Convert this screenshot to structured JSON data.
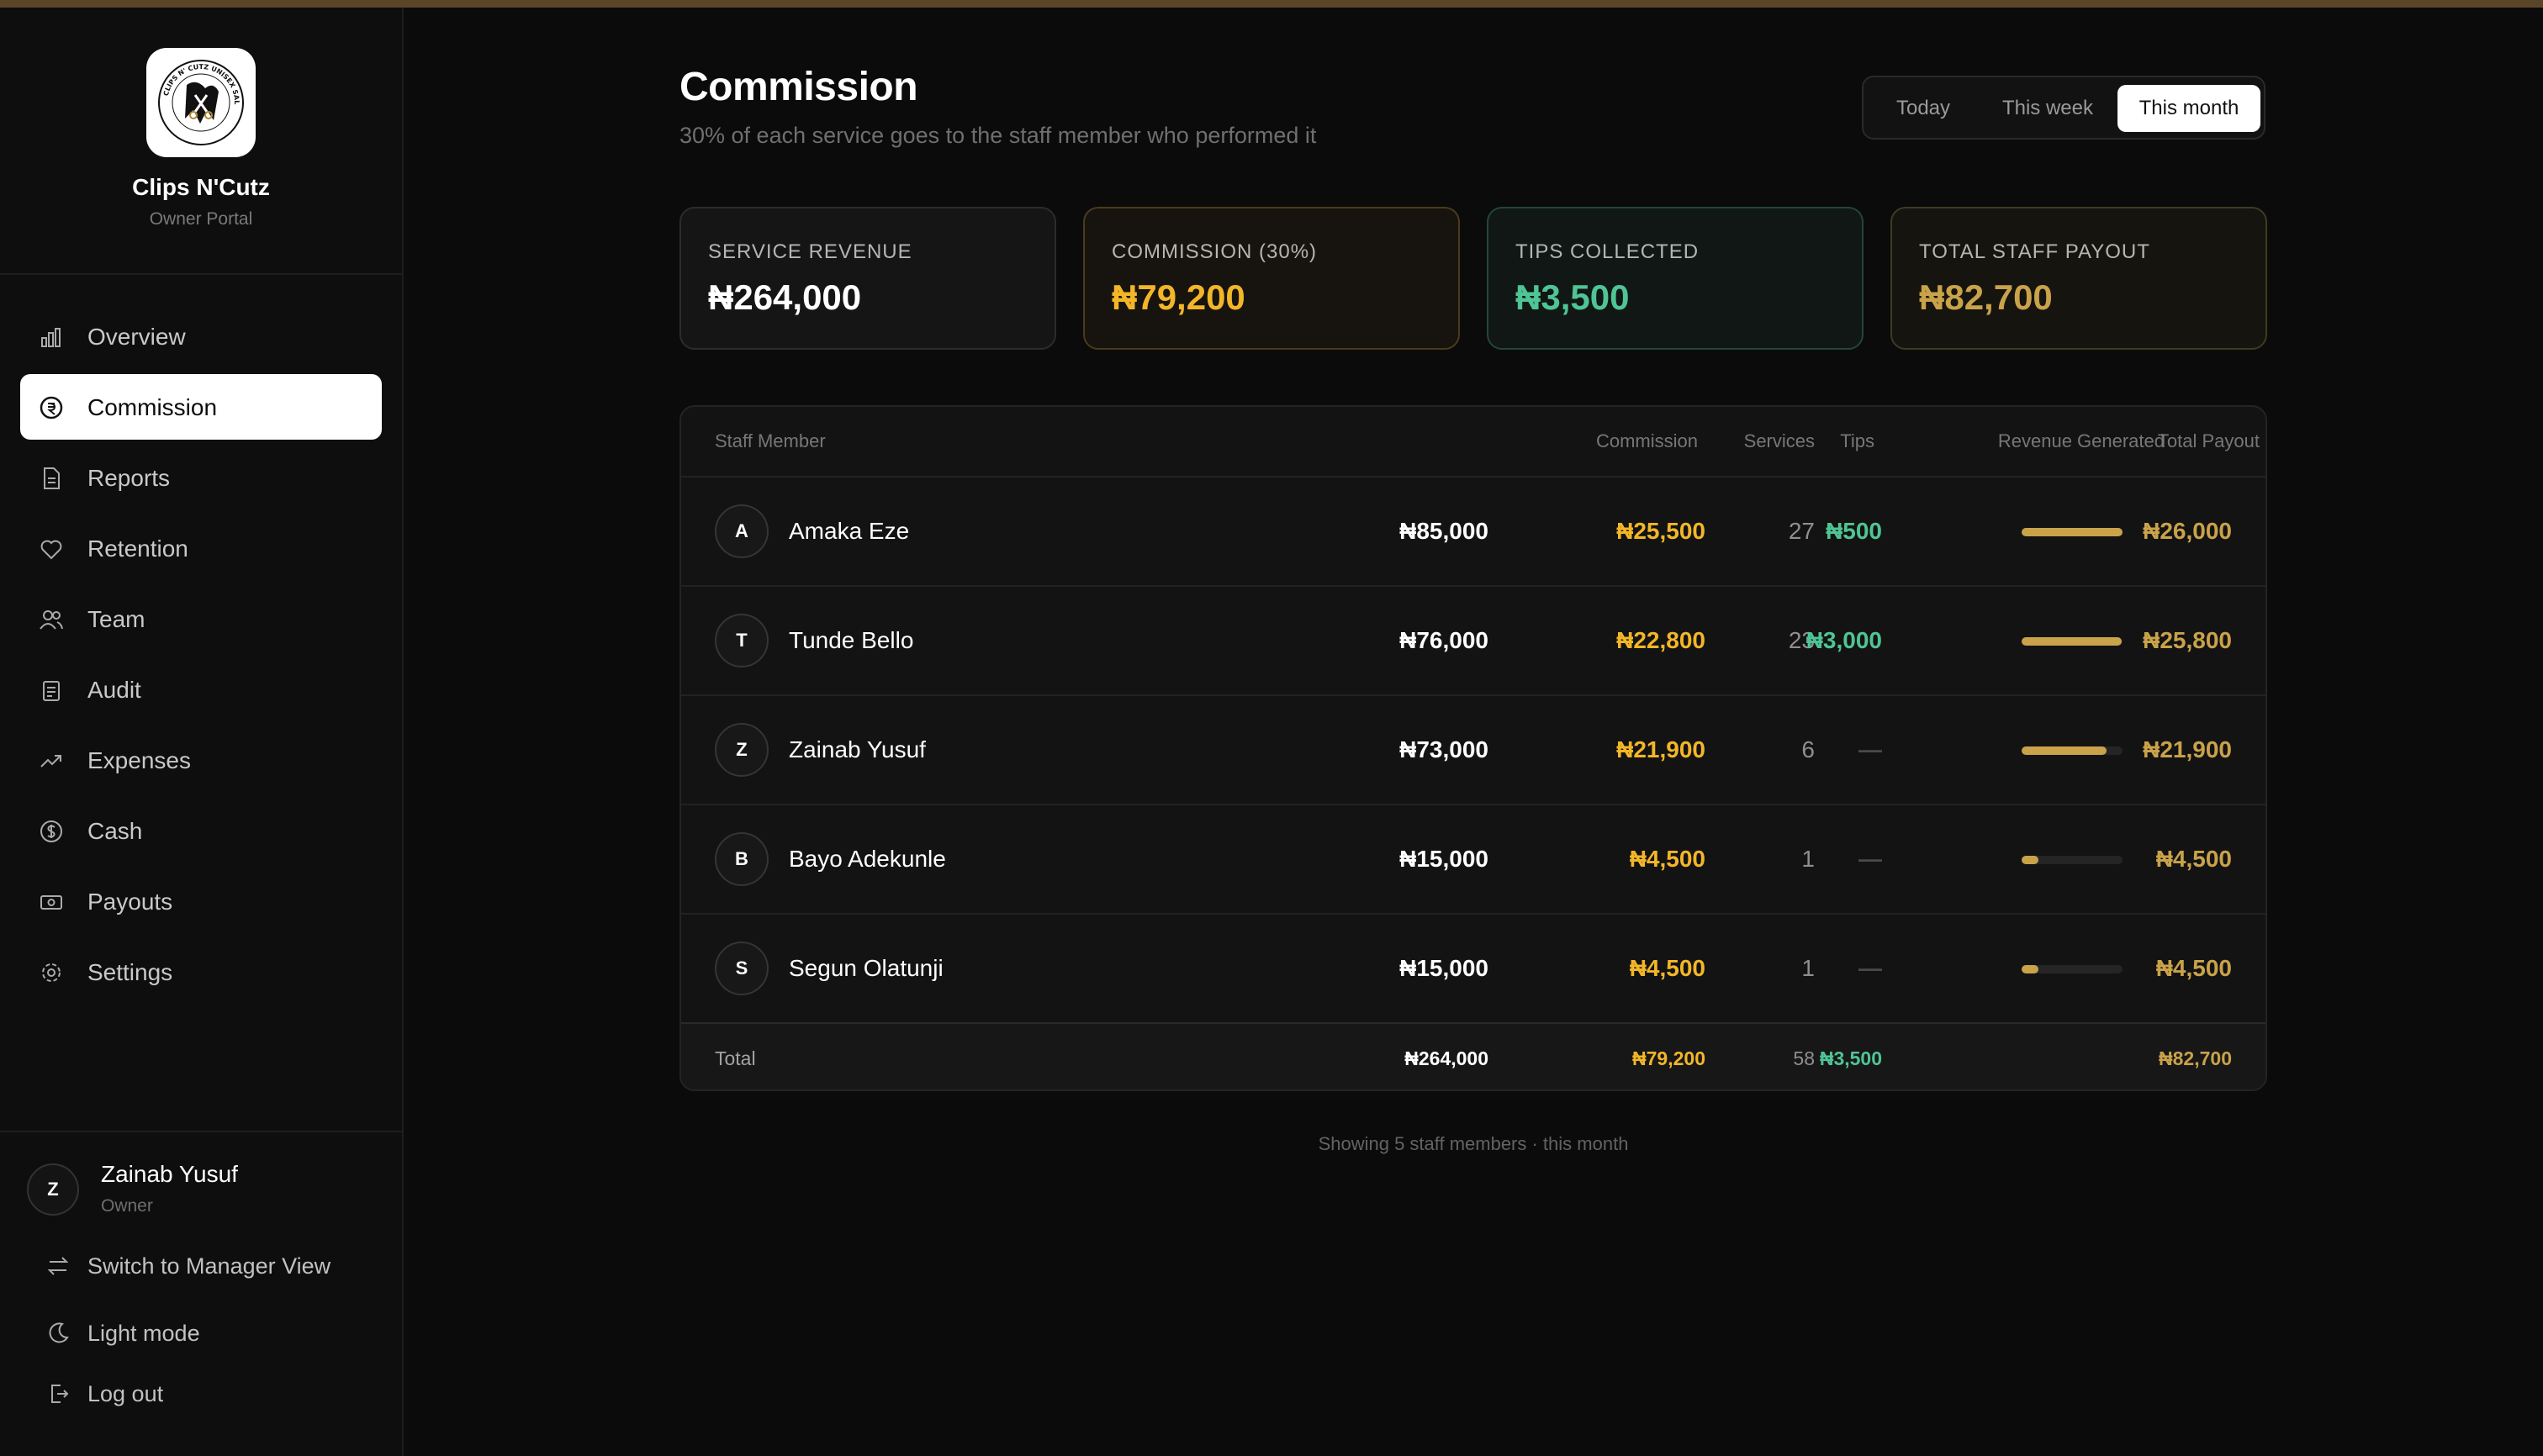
{
  "colors": {
    "accent_gold": "#c9a24a",
    "commission_yellow": "#f2b628",
    "tips_green": "#4fc495",
    "payout_gold": "#c9a24a"
  },
  "brand": {
    "name": "Clips N'Cutz",
    "subtitle": "Owner Portal",
    "logo_text": "CLIPS N' CUTZ UNISEX SALON"
  },
  "nav": [
    {
      "label": "Overview",
      "icon": "bar-chart-icon"
    },
    {
      "label": "Commission",
      "icon": "commission-icon",
      "active": true
    },
    {
      "label": "Reports",
      "icon": "document-icon"
    },
    {
      "label": "Retention",
      "icon": "heart-icon"
    },
    {
      "label": "Team",
      "icon": "users-icon"
    },
    {
      "label": "Audit",
      "icon": "clipboard-icon"
    },
    {
      "label": "Expenses",
      "icon": "trending-up-icon"
    },
    {
      "label": "Cash",
      "icon": "dollar-circle-icon"
    },
    {
      "label": "Payouts",
      "icon": "banknote-icon"
    },
    {
      "label": "Settings",
      "icon": "gear-icon"
    }
  ],
  "user": {
    "initial": "Z",
    "name": "Zainab Yusuf",
    "role": "Owner"
  },
  "sidebar_actions": {
    "switch_view": "Switch to Manager View",
    "theme": "Light mode",
    "logout": "Log out"
  },
  "header": {
    "title": "Commission",
    "subtitle": "30% of each service goes to the staff member who performed it"
  },
  "range": {
    "options": [
      "Today",
      "This week",
      "This month"
    ],
    "selected": "This month"
  },
  "cards": [
    {
      "label": "SERVICE REVENUE",
      "value": "₦264,000"
    },
    {
      "label": "COMMISSION (30%)",
      "value": "₦79,200"
    },
    {
      "label": "TIPS COLLECTED",
      "value": "₦3,500"
    },
    {
      "label": "TOTAL STAFF PAYOUT",
      "value": "₦82,700"
    }
  ],
  "table": {
    "columns": [
      "Staff Member",
      "Services",
      "Revenue Generated",
      "Commission",
      "Tips",
      "Total Payout"
    ],
    "rows": [
      {
        "initial": "A",
        "name": "Amaka Eze",
        "services": "27",
        "revenue": "₦85,000",
        "commission": "₦25,500",
        "tips": "₦500",
        "payout": "₦26,000",
        "payout_share": 1.0
      },
      {
        "initial": "T",
        "name": "Tunde Bello",
        "services": "23",
        "revenue": "₦76,000",
        "commission": "₦22,800",
        "tips": "₦3,000",
        "payout": "₦25,800",
        "payout_share": 0.99
      },
      {
        "initial": "Z",
        "name": "Zainab Yusuf",
        "services": "6",
        "revenue": "₦73,000",
        "commission": "₦21,900",
        "tips": "—",
        "payout": "₦21,900",
        "payout_share": 0.84
      },
      {
        "initial": "B",
        "name": "Bayo Adekunle",
        "services": "1",
        "revenue": "₦15,000",
        "commission": "₦4,500",
        "tips": "—",
        "payout": "₦4,500",
        "payout_share": 0.17
      },
      {
        "initial": "S",
        "name": "Segun Olatunji",
        "services": "1",
        "revenue": "₦15,000",
        "commission": "₦4,500",
        "tips": "—",
        "payout": "₦4,500",
        "payout_share": 0.17
      }
    ],
    "total": {
      "label": "Total",
      "services": "58",
      "revenue": "₦264,000",
      "commission": "₦79,200",
      "tips": "₦3,500",
      "payout": "₦82,700"
    }
  },
  "footer_note": "Showing 5 staff members · this month"
}
